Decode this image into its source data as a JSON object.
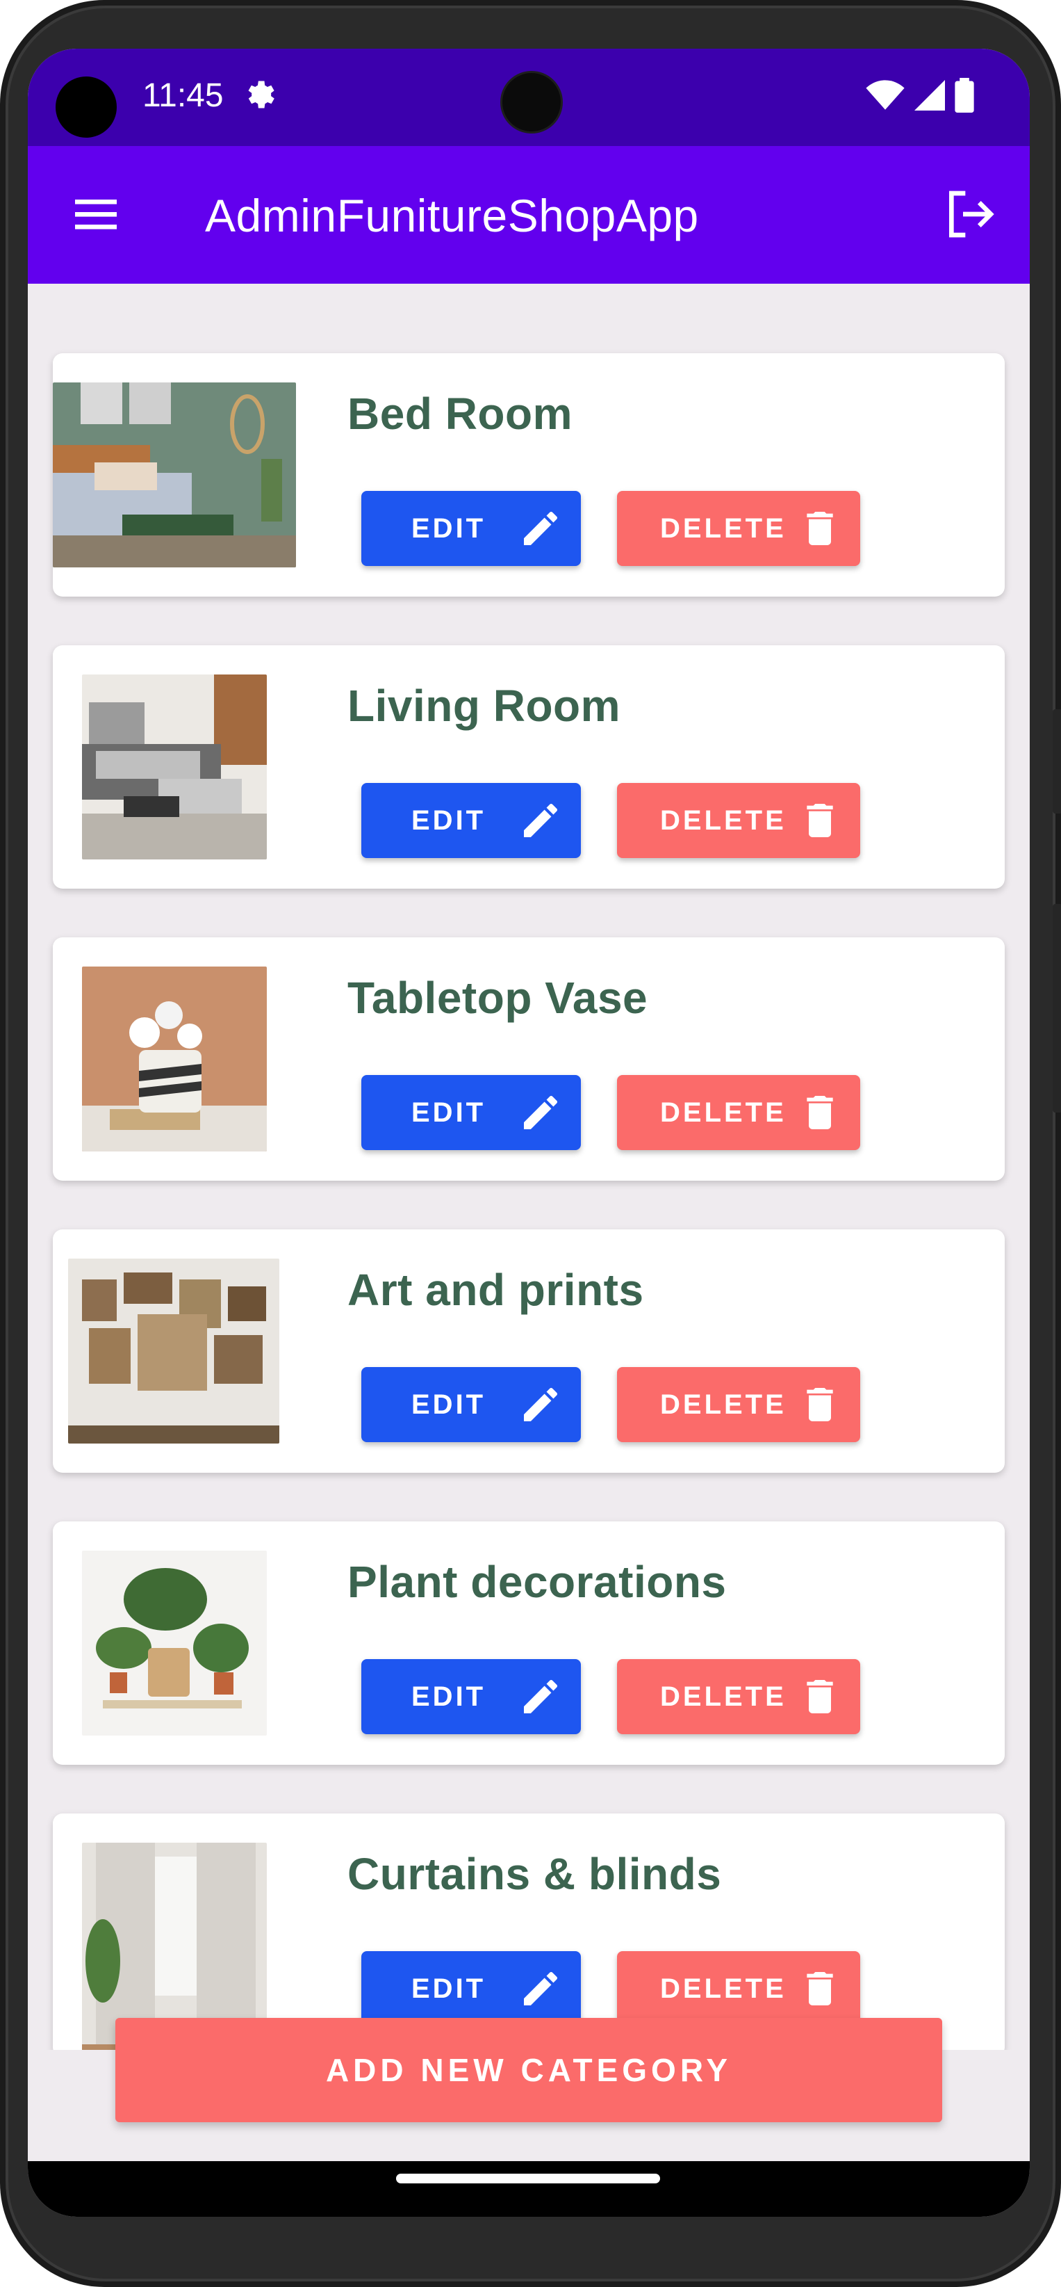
{
  "status_bar": {
    "time": "11:45"
  },
  "app_bar": {
    "title": "AdminFunitureShopApp"
  },
  "categories": [
    {
      "name": "Bed Room",
      "edit_label": "EDIT",
      "delete_label": "DELETE"
    },
    {
      "name": "Living Room",
      "edit_label": "EDIT",
      "delete_label": "DELETE"
    },
    {
      "name": "Tabletop Vase",
      "edit_label": "EDIT",
      "delete_label": "DELETE"
    },
    {
      "name": "Art and prints",
      "edit_label": "EDIT",
      "delete_label": "DELETE"
    },
    {
      "name": "Plant decorations",
      "edit_label": "EDIT",
      "delete_label": "DELETE"
    },
    {
      "name": "Curtains & blinds",
      "edit_label": "EDIT",
      "delete_label": "DELETE"
    }
  ],
  "add_button": {
    "label": "ADD NEW CATEGORY"
  },
  "colors": {
    "status_bar": "#3c00ad",
    "app_bar": "#6200ee",
    "edit_button": "#1e56f0",
    "delete_button": "#fb6b6a",
    "title_text": "#3c6450"
  },
  "icons": {
    "menu": "menu-icon",
    "logout": "logout-icon",
    "edit": "pencil-icon",
    "delete": "trash-icon",
    "settings": "gear-icon",
    "wifi": "wifi-icon",
    "signal": "signal-icon",
    "battery": "battery-icon"
  }
}
